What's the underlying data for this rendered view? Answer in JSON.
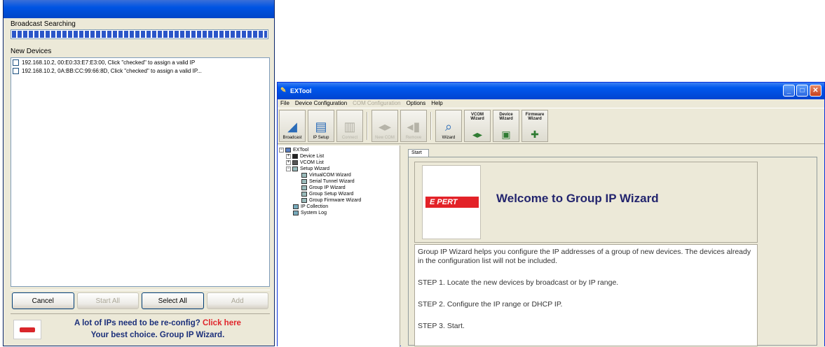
{
  "search_dialog": {
    "broadcast_label": "Broadcast Searching",
    "progress_fraction": 1.0,
    "new_devices_label": "New Devices",
    "devices": [
      "192.168.10.2, 00:E0:33:E7:E3:00, Click \"checked\" to assign a valid IP",
      "192.168.10.2, 0A:BB:CC:99:66:8D, Click \"checked\" to assign a valid IP..."
    ],
    "buttons": {
      "cancel": "Cancel",
      "start_all": "Start All",
      "select_all": "Select All",
      "add": "Add"
    },
    "promo": {
      "line1_prefix": "A lot of IPs need to be re-config?",
      "line1_link": "Click here",
      "line2": "Your best choice. Group IP Wizard."
    }
  },
  "main_window": {
    "title": "EXTool",
    "menu": [
      "File",
      "Device Configuration",
      "COM Configuration",
      "Options",
      "Help"
    ],
    "menu_disabled": [
      "COM Configuration"
    ],
    "toolbar": {
      "broadcast": "Broadcast",
      "ip_setup": "IP Setup",
      "connect": "Connect",
      "new_com": "New COM",
      "remove": "Remove",
      "wizard": "Wizard",
      "vcom_wizard": "VCOM Wizard",
      "device_wizard": "Device Wizard",
      "firmware_wizard": "Firmware Wizard"
    },
    "tree": [
      {
        "label": "EXTool",
        "level": 0
      },
      {
        "label": "Device List",
        "level": 1
      },
      {
        "label": "VCOM List",
        "level": 1
      },
      {
        "label": "Setup Wizard",
        "level": 1
      },
      {
        "label": "VirtualCOM Wizard",
        "level": 2
      },
      {
        "label": "Serial Tunnel Wizard",
        "level": 2
      },
      {
        "label": "Group IP Wizard",
        "level": 2
      },
      {
        "label": "Group Setup Wizard",
        "level": 2
      },
      {
        "label": "Group Firmware Wizard",
        "level": 2
      },
      {
        "label": "IP Collection",
        "level": 1
      },
      {
        "label": "System Log",
        "level": 1
      }
    ],
    "tab_label": "Start",
    "welcome_title": "Welcome to Group IP Wizard",
    "logo_text": "E PERT",
    "description": "Group IP Wizard helps you configure the IP addresses of a group of new devices. The devices already in the configuration list will not be included.",
    "steps": [
      "STEP 1. Locate the new devices by broadcast or by IP range.",
      "STEP 2. Configure the IP range or DHCP IP.",
      "STEP 3. Start."
    ]
  }
}
